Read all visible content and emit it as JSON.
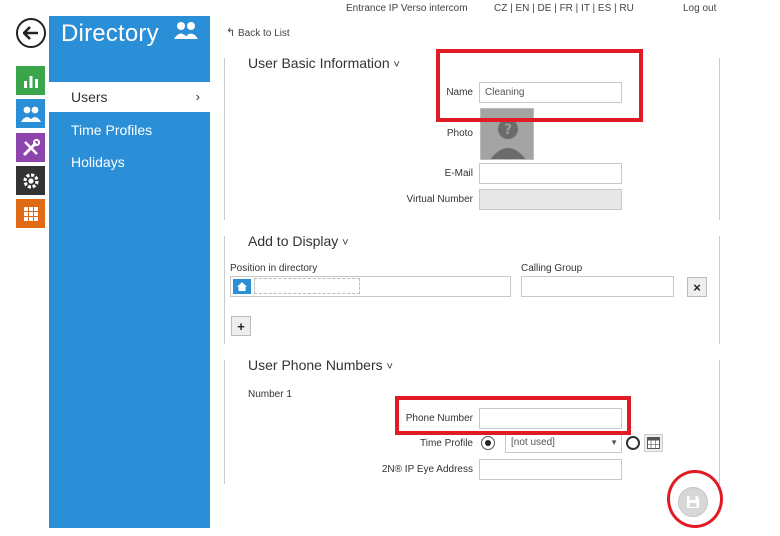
{
  "topbar": {
    "device": "Entrance IP Verso intercom",
    "languages": "CZ | EN | DE | FR | IT | ES | RU",
    "logout": "Log out"
  },
  "sidebar": {
    "title": "Directory",
    "items": [
      {
        "label": "Users",
        "active": true
      },
      {
        "label": "Time Profiles",
        "active": false
      },
      {
        "label": "Holidays",
        "active": false
      }
    ]
  },
  "rail": {
    "icons": [
      "back-arrow-icon",
      "chart-icon",
      "users-icon",
      "tools-icon",
      "gear-icon",
      "grid-icon"
    ],
    "colors": [
      "#3aa54b",
      "#2a8fd7",
      "#8e44ad",
      "#333333",
      "#e06a16"
    ]
  },
  "back_to_list": "Back to List",
  "basic": {
    "title": "User Basic Information",
    "name_label": "Name",
    "name_value": "Cleaning",
    "photo_label": "Photo",
    "email_label": "E-Mail",
    "email_value": "",
    "virtual_label": "Virtual Number",
    "virtual_value": ""
  },
  "display": {
    "title": "Add to Display",
    "position_label": "Position in directory",
    "calling_label": "Calling Group",
    "calling_value": "",
    "remove_symbol": "×",
    "add_symbol": "+"
  },
  "phones": {
    "title": "User Phone Numbers",
    "number_label": "Number 1",
    "phone_label": "Phone Number",
    "phone_value": "",
    "time_label": "Time Profile",
    "time_value": "[not used]",
    "eye_label": "2N® IP Eye Address",
    "eye_value": ""
  },
  "chevron": "˅"
}
